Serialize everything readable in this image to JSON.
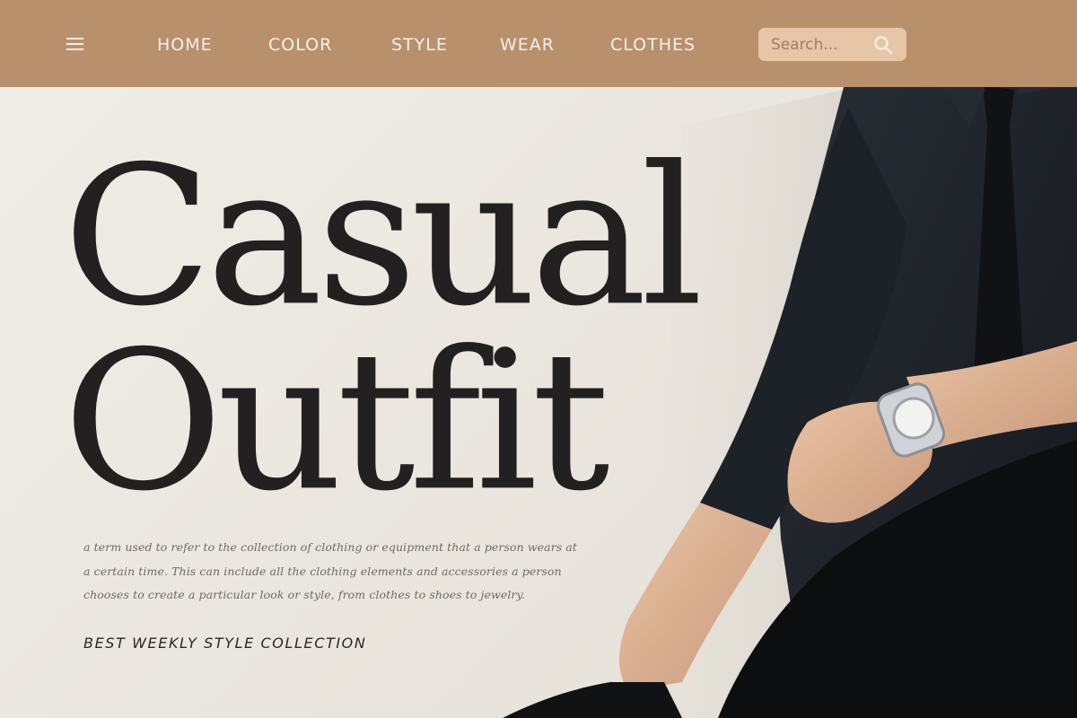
{
  "nav": {
    "items": [
      {
        "label": "HOME"
      },
      {
        "label": "COLOR"
      },
      {
        "label": "STYLE"
      },
      {
        "label": "WEAR"
      },
      {
        "label": "CLOTHES"
      }
    ]
  },
  "search": {
    "placeholder": "Search..."
  },
  "hero": {
    "title_line1": "Casual",
    "title_line2": "Outfit",
    "description": "a term used to refer to the collection of clothing or equipment that a person wears at a certain time. This can include all the clothing elements and accessories a person chooses to create a particular look or style, from clothes to shoes to jewelry.",
    "tagline": "BEST WEEKLY STYLE COLLECTION"
  },
  "colors": {
    "header_bg": "#b9906c",
    "search_bg": "#e6c6a6",
    "page_bg": "#ece8e1",
    "title_text": "#222020",
    "shirt": "#1e2229"
  },
  "icons": {
    "menu": "hamburger-menu-icon",
    "search": "search-icon"
  }
}
